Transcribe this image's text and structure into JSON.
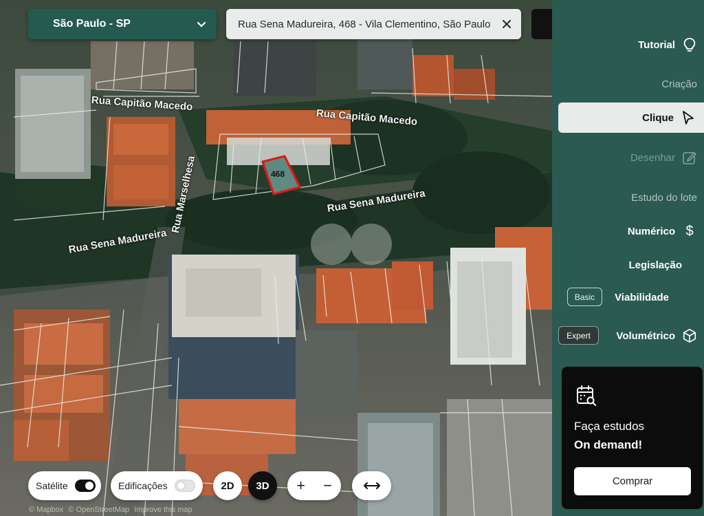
{
  "city_selector": {
    "value": "São Paulo - SP"
  },
  "address_search": {
    "value": "Rua Sena Madureira, 468 - Vila Clementino, São Paulo"
  },
  "map": {
    "lot_number": "468",
    "street_labels": [
      "Rua Capitão Macedo",
      "Rua Capitão Macedo",
      "Rua Sena Madureira",
      "Rua Sena Madureira",
      "Rua Marselhesa"
    ],
    "attribution": [
      "© Mapbox",
      "© OpenStreetMap",
      "Improve this map"
    ]
  },
  "map_controls": {
    "satellite_label": "Satélite",
    "satellite_on": true,
    "buildings_label": "Edificações",
    "buildings_on": false,
    "view_2d": "2D",
    "view_3d": "3D",
    "active_view": "3D",
    "zoom_in": "+",
    "zoom_out": "−",
    "expand": "↔"
  },
  "sidebar": {
    "items": [
      {
        "label": "Tutorial",
        "icon": "lightbulb-icon"
      },
      {
        "label": "Criação"
      },
      {
        "label": "Clique",
        "icon": "cursor-arrow-icon",
        "active": true
      },
      {
        "label": "Desenhar",
        "icon": "pencil-square-icon",
        "disabled": true
      },
      {
        "label": "Estudo do lote"
      },
      {
        "label": "Numérico",
        "icon": "dollar-icon"
      },
      {
        "label": "Legislação"
      },
      {
        "label": "Viabilidade",
        "badge": "Basic"
      },
      {
        "label": "Volumétrico",
        "badge": "Expert",
        "icon": "cube-icon"
      }
    ],
    "promo": {
      "icon": "calendar-search-icon",
      "line1": "Faça estudos",
      "line2": "On demand!",
      "button": "Comprar"
    }
  },
  "colors": {
    "sidebar_bg": "#2a5a50",
    "city_select_bg": "#255a50",
    "lot_highlight": "#e0191c",
    "active_item_bg": "#e8ebea"
  }
}
